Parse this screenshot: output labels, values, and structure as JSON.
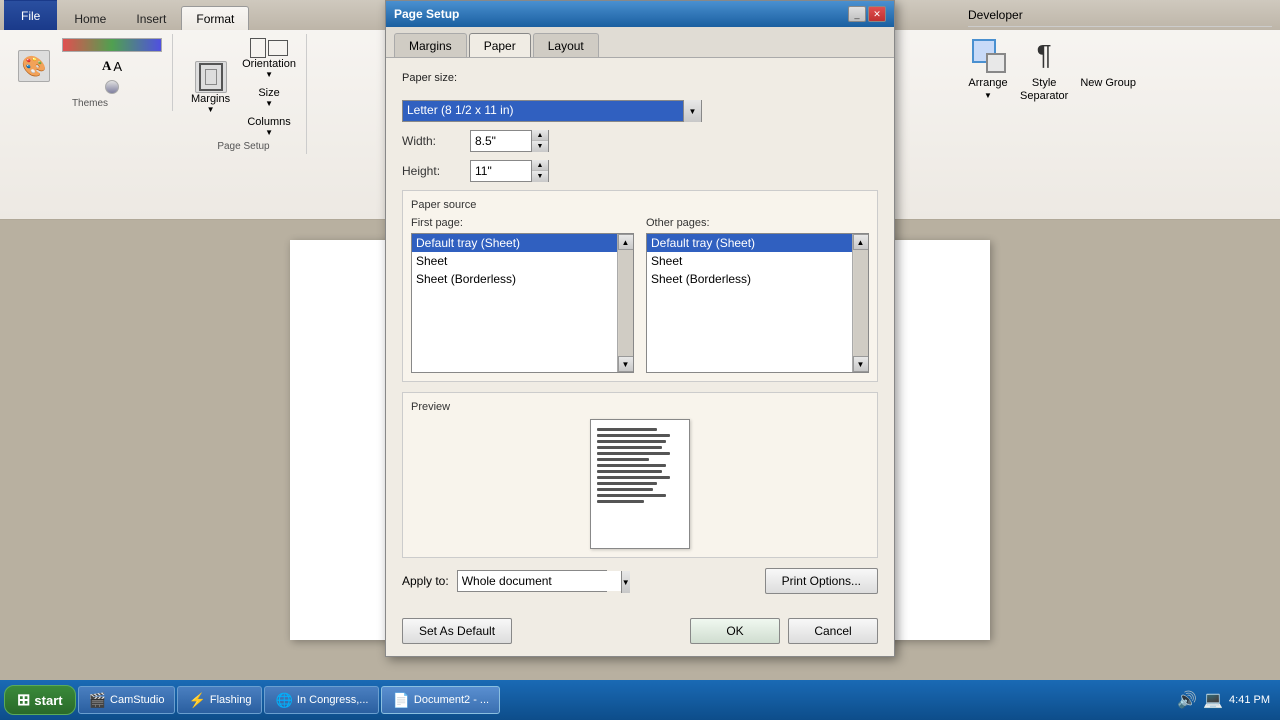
{
  "ribbon": {
    "tabs": [
      {
        "id": "file",
        "label": "File",
        "active": false
      },
      {
        "id": "home",
        "label": "Home",
        "active": false
      },
      {
        "id": "insert",
        "label": "Insert",
        "active": false
      },
      {
        "id": "format",
        "label": "Format",
        "active": true
      },
      {
        "id": "developer",
        "label": "Developer",
        "active": false
      }
    ],
    "themes_label": "Themes",
    "margins_label": "Margins",
    "page_setup_label": "Page Setup",
    "orientation_label": "Orientation",
    "size_label": "Size",
    "columns_label": "Columns",
    "arrange_label": "Arrange",
    "style_separator_label": "Style\nSeparator",
    "new_group_label": "New Group"
  },
  "dialog": {
    "title": "Page Setup",
    "tabs": [
      {
        "id": "margins",
        "label": "Margins",
        "active": false
      },
      {
        "id": "paper",
        "label": "Paper",
        "active": true
      },
      {
        "id": "layout",
        "label": "Layout",
        "active": false
      }
    ],
    "paper_size_label": "Paper size:",
    "paper_size_value": "Letter (8 1/2 x 11 in)",
    "width_label": "Width:",
    "width_value": "8.5\"",
    "height_label": "Height:",
    "height_value": "11\"",
    "paper_source_label": "Paper source",
    "first_page_label": "First page:",
    "other_pages_label": "Other pages:",
    "first_page_items": [
      {
        "label": "Default tray (Sheet)",
        "selected": true
      },
      {
        "label": "Sheet",
        "selected": false
      },
      {
        "label": "Sheet (Borderless)",
        "selected": false
      }
    ],
    "other_pages_items": [
      {
        "label": "Default tray (Sheet)",
        "selected": true
      },
      {
        "label": "Sheet",
        "selected": false
      },
      {
        "label": "Sheet (Borderless)",
        "selected": false
      }
    ],
    "preview_label": "Preview",
    "apply_to_label": "Apply to:",
    "apply_to_value": "Whole document",
    "print_options_label": "Print Options...",
    "set_as_default_label": "Set As Default",
    "ok_label": "OK",
    "cancel_label": "Cancel"
  },
  "taskbar": {
    "start_label": "start",
    "btn1": "CamStudio",
    "btn2": "Flashing",
    "btn3": "In Congress,...",
    "btn4": "Document2 - ...",
    "time": "4:41 PM"
  }
}
